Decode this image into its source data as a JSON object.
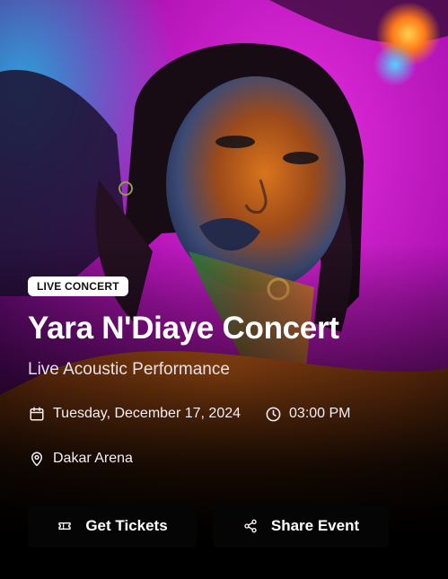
{
  "event": {
    "badge": "LIVE CONCERT",
    "title": "Yara N'Diaye Concert",
    "subtitle": "Live Acoustic Performance",
    "date": "Tuesday, December 17, 2024",
    "time": "03:00 PM",
    "location": "Dakar Arena"
  },
  "actions": {
    "tickets_label": "Get Tickets",
    "share_label": "Share Event"
  },
  "icons": {
    "date": "calendar-icon",
    "time": "clock-icon",
    "location": "map-pin-icon",
    "tickets": "ticket-icon",
    "share": "share-icon"
  },
  "colors": {
    "accent_magenta": "#d81bd0",
    "accent_orange": "#f07a1c",
    "badge_bg": "#ffffff",
    "button_bg": "#050505"
  }
}
